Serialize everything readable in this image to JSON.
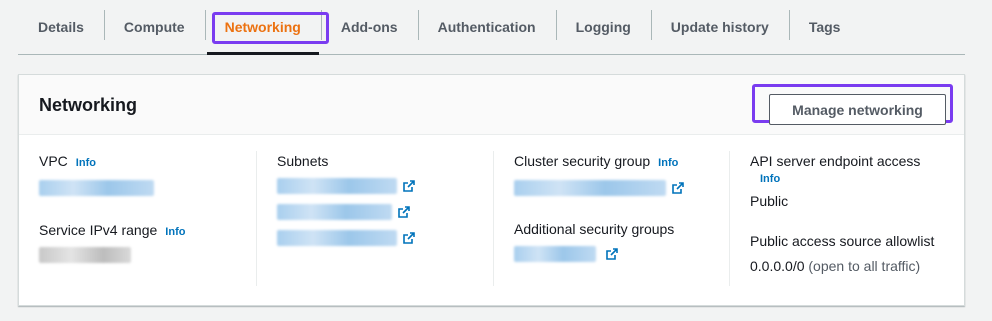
{
  "tabs": [
    {
      "label": "Details"
    },
    {
      "label": "Compute"
    },
    {
      "label": "Networking"
    },
    {
      "label": "Add-ons"
    },
    {
      "label": "Authentication"
    },
    {
      "label": "Logging"
    },
    {
      "label": "Update history"
    },
    {
      "label": "Tags"
    }
  ],
  "active_tab": "Networking",
  "panel": {
    "title": "Networking",
    "manage_button": "Manage networking"
  },
  "vpc": {
    "label": "VPC",
    "info": "Info"
  },
  "subnets": {
    "label": "Subnets"
  },
  "service_ipv4": {
    "label": "Service IPv4 range",
    "info": "Info"
  },
  "cluster_sg": {
    "label": "Cluster security group",
    "info": "Info"
  },
  "additional_sg": {
    "label": "Additional security groups"
  },
  "api_endpoint": {
    "label": "API server endpoint access",
    "info": "Info",
    "value": "Public"
  },
  "public_allowlist": {
    "label": "Public access source allowlist",
    "value": "0.0.0.0/0",
    "note": "(open to all traffic)"
  },
  "colors": {
    "accent": "#ec7211",
    "link": "#0073bb",
    "highlight": "#7a3cf0"
  },
  "icons": [
    "external-link-icon"
  ]
}
